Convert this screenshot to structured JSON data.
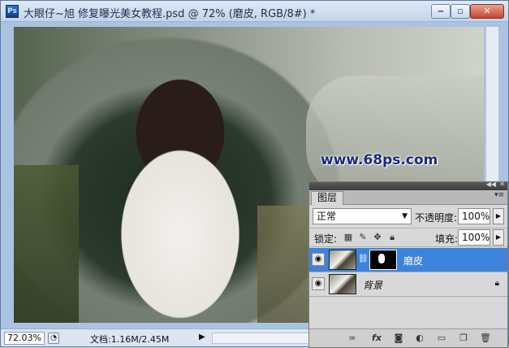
{
  "window": {
    "title": "大眼仔~旭 修复曝光美女教程.psd @ 72% (磨皮, RGB/8#) *",
    "app_icon": "Ps"
  },
  "canvas": {
    "watermark": "www.68ps.com"
  },
  "status": {
    "zoom": "72.03%",
    "doc_info": "文档:1.16M/2.45M"
  },
  "layers_panel": {
    "tab_label": "图层",
    "blend_mode": "正常",
    "opacity_label": "不透明度:",
    "opacity_value": "100%",
    "lock_label": "锁定:",
    "fill_label": "填充:",
    "fill_value": "100%",
    "layers": [
      {
        "name": "磨皮",
        "selected": true
      },
      {
        "name": "背景",
        "selected": false
      }
    ],
    "bottom_icons": [
      "link-icon",
      "fx-icon",
      "mask-icon",
      "adjustment-icon",
      "group-folder-icon",
      "new-layer-icon",
      "trash-icon"
    ]
  },
  "colors": {
    "selected_layer": "#3d83dc",
    "watermark": "#1d2a7a",
    "close_button": "#c4452b"
  }
}
